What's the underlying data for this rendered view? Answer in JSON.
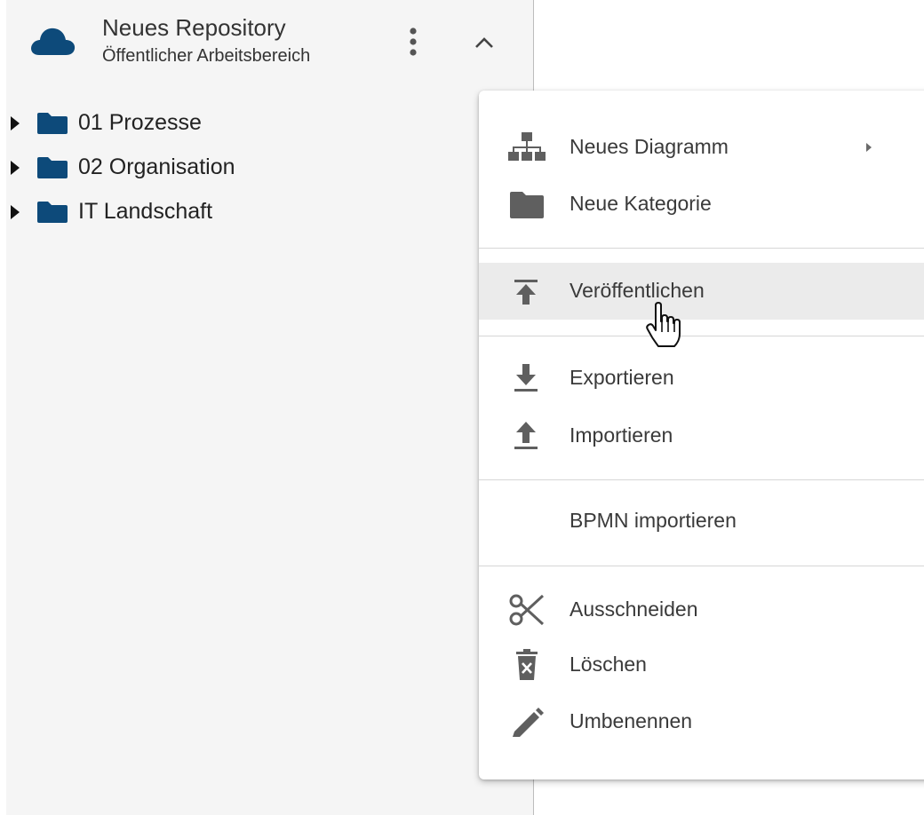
{
  "colors": {
    "accent": "#0d4a7a",
    "panel_background": "#f5f5f5",
    "menu_hover": "#ebebeb",
    "icon_gray": "#5f5f5f"
  },
  "repository": {
    "title": "Neues Repository",
    "subtitle": "Öffentlicher Arbeitsbereich",
    "icon": "cloud-icon",
    "more_icon": "more-vertical-icon",
    "collapse_icon": "chevron-up-icon"
  },
  "tree": {
    "items": [
      {
        "label": "01 Prozesse",
        "icon": "folder-icon",
        "expander": "caret-right-icon"
      },
      {
        "label": "02 Organisation",
        "icon": "folder-icon",
        "expander": "caret-right-icon"
      },
      {
        "label": "IT Landschaft",
        "icon": "folder-icon",
        "expander": "caret-right-icon"
      }
    ]
  },
  "context_menu": {
    "groups": [
      [
        {
          "label": "Neues Diagramm",
          "icon": "sitemap-icon",
          "has_submenu": true
        },
        {
          "label": "Neue Kategorie",
          "icon": "folder-icon"
        }
      ],
      [
        {
          "label": "Veröffentlichen",
          "icon": "publish-icon",
          "hovered": true
        }
      ],
      [
        {
          "label": "Exportieren",
          "icon": "download-icon"
        },
        {
          "label": "Importieren",
          "icon": "upload-icon"
        }
      ],
      [
        {
          "label": "BPMN importieren",
          "icon": ""
        }
      ],
      [
        {
          "label": "Ausschneiden",
          "icon": "scissors-icon"
        },
        {
          "label": "Löschen",
          "icon": "trash-icon"
        },
        {
          "label": "Umbenennen",
          "icon": "pencil-icon"
        }
      ]
    ]
  },
  "pointer": "hand-pointer-icon"
}
